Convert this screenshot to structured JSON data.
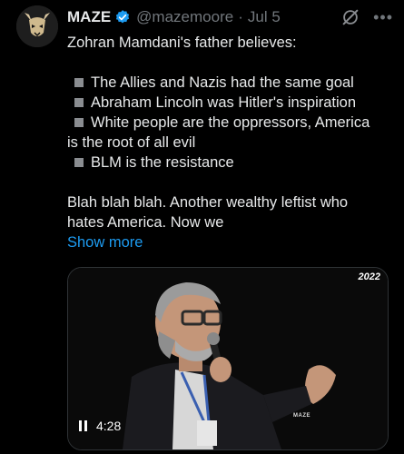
{
  "author": {
    "name": "MAZE",
    "handle": "@mazemoore",
    "separator": "·",
    "date": "Jul 5"
  },
  "icons": {
    "avatar": "mask-avatar-icon",
    "verified": "verified-badge-icon",
    "grok": "grok-icon",
    "more": "more-options-icon"
  },
  "colors": {
    "accent": "#1d9bf0",
    "text": "#e7e9ea",
    "muted": "#71767b",
    "background": "#000000"
  },
  "tweet": {
    "intro": "Zohran Mamdani's father believes:",
    "bullets": [
      "The Allies and Nazis had the same goal",
      "Abraham Lincoln was Hitler's inspiration",
      "White people are the oppressors, America",
      "BLM is the resistance"
    ],
    "bullet3_cont": "is the root of all evil",
    "para_line1": "Blah blah blah. Another wealthy leftist who",
    "para_line2": "hates America. Now we",
    "show_more": "Show more"
  },
  "video": {
    "year_badge": "2022",
    "watermark": "MAZE",
    "duration": "4:28",
    "state": "playing"
  }
}
